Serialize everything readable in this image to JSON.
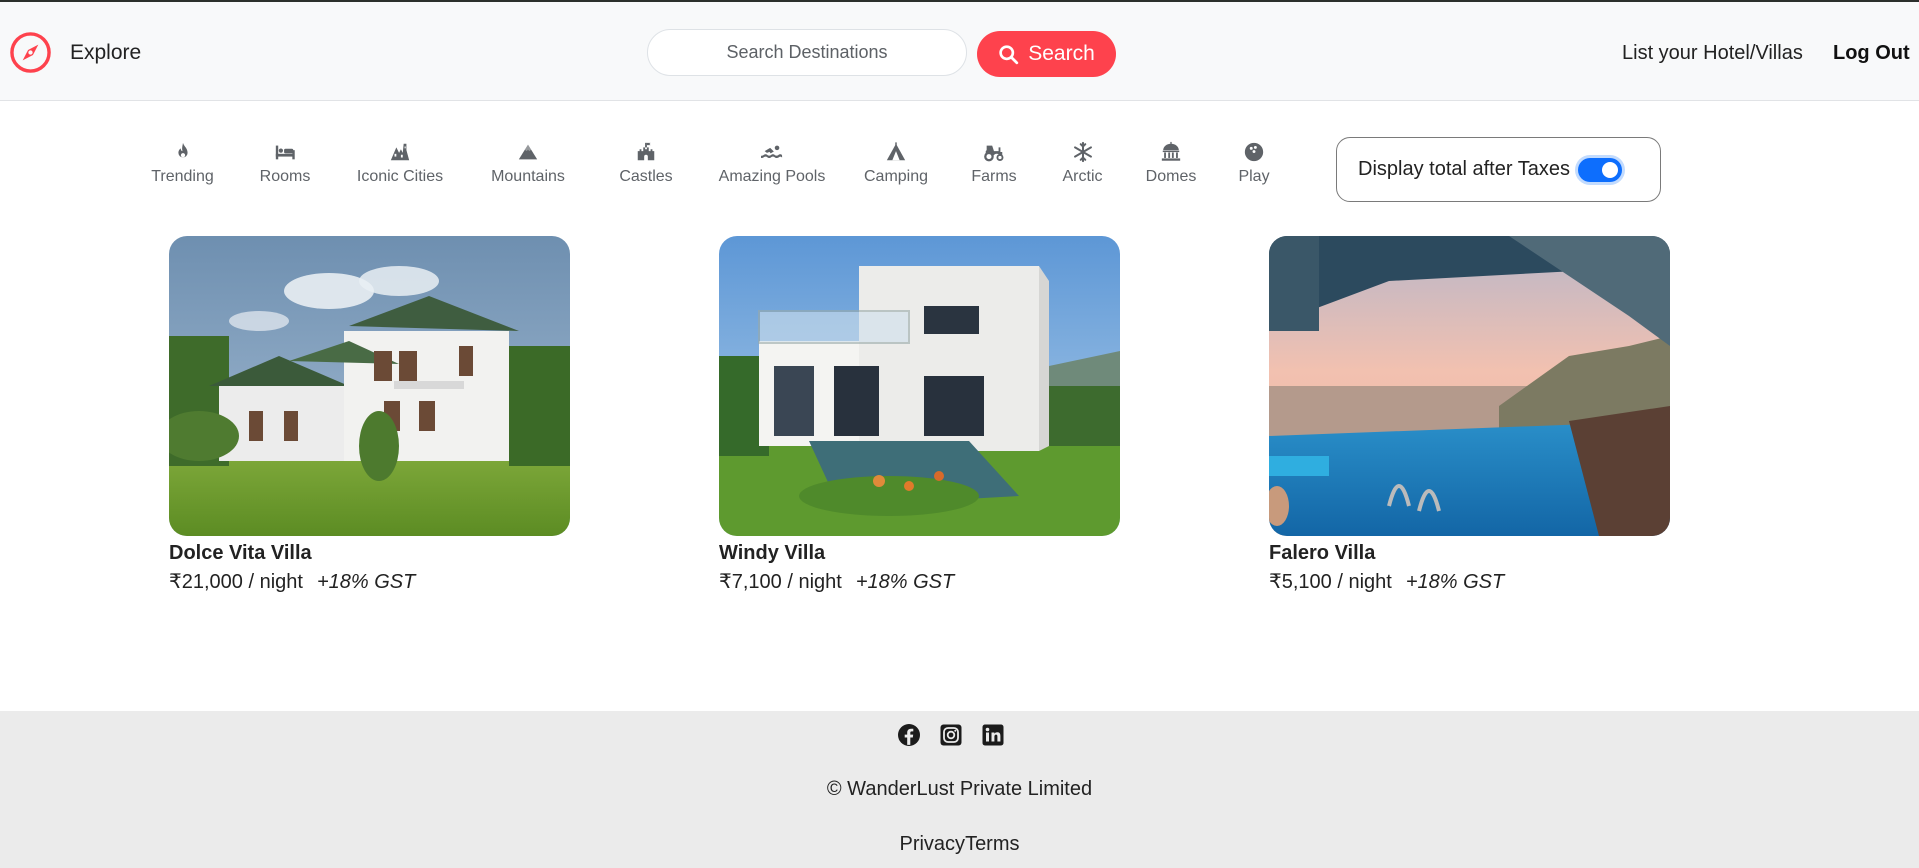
{
  "nav": {
    "explore": "Explore",
    "search_placeholder": "Search Destinations",
    "search_button": "Search",
    "list_hotel": "List your Hotel/Villas",
    "logout": "Log Out",
    "brand_icon": "compass-icon",
    "accent": "#fe424d"
  },
  "filters": [
    {
      "label": "Trending",
      "icon": "fire-icon"
    },
    {
      "label": "Rooms",
      "icon": "bed-icon"
    },
    {
      "label": "Iconic Cities",
      "icon": "city-icon"
    },
    {
      "label": "Mountains",
      "icon": "mountain-icon"
    },
    {
      "label": "Castles",
      "icon": "castle-icon"
    },
    {
      "label": "Amazing Pools",
      "icon": "swimmer-icon"
    },
    {
      "label": "Camping",
      "icon": "tent-icon"
    },
    {
      "label": "Farms",
      "icon": "tractor-icon"
    },
    {
      "label": "Arctic",
      "icon": "snowflake-icon"
    },
    {
      "label": "Domes",
      "icon": "dome-icon"
    },
    {
      "label": "Play",
      "icon": "bowling-ball-icon"
    }
  ],
  "tax_toggle": {
    "label": "Display total after Taxes",
    "checked": true
  },
  "listings": [
    {
      "title": "Dolce Vita Villa",
      "price": "₹21,000 / night",
      "gst": "+18% GST"
    },
    {
      "title": "Windy Villa",
      "price": "₹7,100 / night",
      "gst": "+18% GST"
    },
    {
      "title": "Falero Villa",
      "price": "₹5,100 / night",
      "gst": "+18% GST"
    }
  ],
  "footer": {
    "socials": [
      "facebook-icon",
      "instagram-icon",
      "linkedin-icon"
    ],
    "copyright": "© WanderLust Private Limited",
    "privacy": "Privacy",
    "terms": "Terms"
  }
}
